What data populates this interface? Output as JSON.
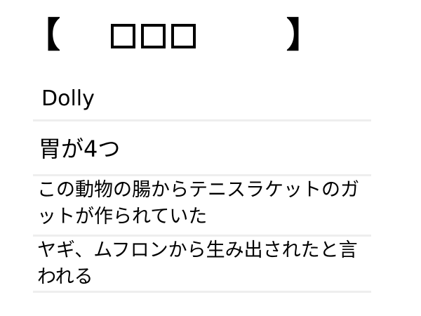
{
  "title": {
    "open_bracket": "【",
    "boxes": [
      "□",
      "□",
      "□"
    ],
    "close_bracket": "】"
  },
  "entries": [
    {
      "text": "Dolly"
    },
    {
      "text": "胃が4つ"
    },
    {
      "text": "この動物の腸からテニスラケットのガットが作られていた"
    },
    {
      "text": "ヤギ、ムフロンから生み出されたと言われる"
    }
  ],
  "colors": {
    "divider": "#eeeeee",
    "text": "#000000",
    "background": "#ffffff"
  }
}
